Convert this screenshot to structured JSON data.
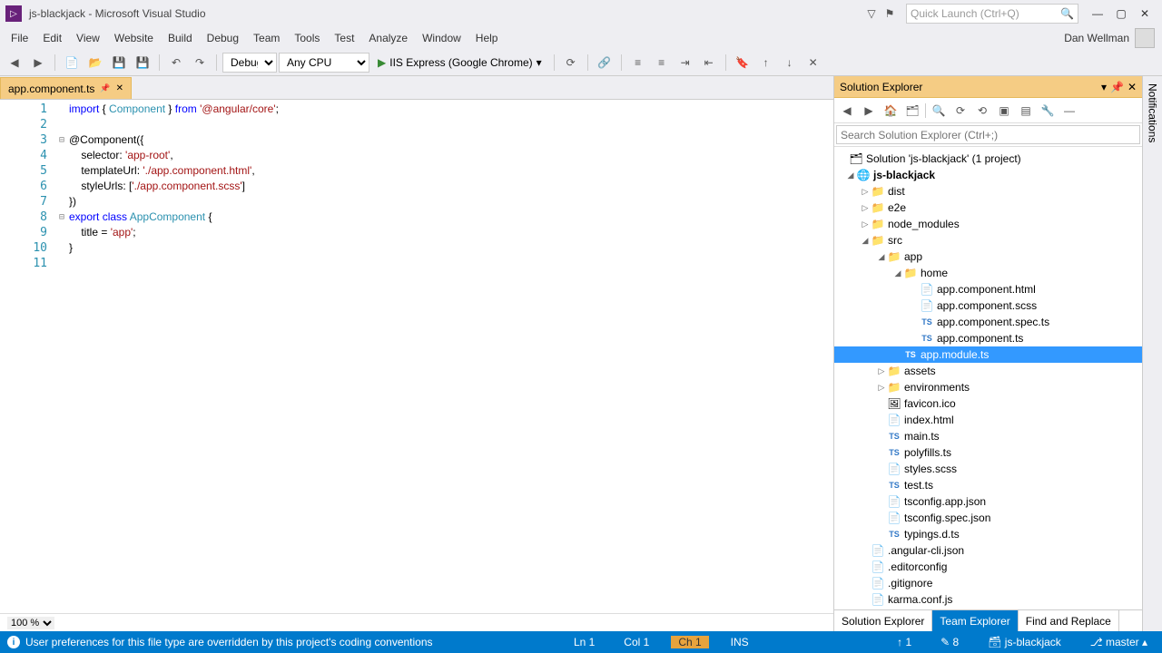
{
  "window": {
    "title": "js-blackjack - Microsoft Visual Studio"
  },
  "quicklaunch": {
    "placeholder": "Quick Launch (Ctrl+Q)"
  },
  "menu": {
    "items": [
      "File",
      "Edit",
      "View",
      "Website",
      "Build",
      "Debug",
      "Team",
      "Tools",
      "Test",
      "Analyze",
      "Window",
      "Help"
    ],
    "user": "Dan Wellman"
  },
  "toolbar": {
    "config": "Debug",
    "platform": "Any CPU",
    "run_label": "IIS Express (Google Chrome)"
  },
  "editor": {
    "tab_name": "app.component.ts",
    "zoom": "100 %",
    "lines": "11"
  },
  "code": {
    "l1a": "import",
    "l1b": " { ",
    "l1c": "Component",
    "l1d": " } ",
    "l1e": "from",
    "l1f": " ",
    "l1g": "'@angular/core'",
    "l1h": ";",
    "l3": "@Component({",
    "l4a": "    selector: ",
    "l4b": "'app-root'",
    "l4c": ",",
    "l5a": "    templateUrl: ",
    "l5b": "'./app.component.html'",
    "l5c": ",",
    "l6a": "    styleUrls: [",
    "l6b": "'./app.component.scss'",
    "l6c": "]",
    "l7": "})",
    "l8a": "export",
    "l8b": " ",
    "l8c": "class",
    "l8d": " ",
    "l8e": "AppComponent",
    "l8f": " {",
    "l9a": "    title = ",
    "l9b": "'app'",
    "l9c": ";",
    "l10": "}"
  },
  "solution": {
    "title": "Solution Explorer",
    "search_placeholder": "Search Solution Explorer (Ctrl+;)",
    "root": "Solution 'js-blackjack' (1 project)",
    "project": "js-blackjack",
    "folders": {
      "dist": "dist",
      "e2e": "e2e",
      "node_modules": "node_modules",
      "src": "src",
      "app": "app",
      "home": "home",
      "assets": "assets",
      "environments": "environments"
    },
    "files": {
      "app_html": "app.component.html",
      "app_scss": "app.component.scss",
      "app_spec": "app.component.spec.ts",
      "app_ts": "app.component.ts",
      "app_module": "app.module.ts",
      "favicon": "favicon.ico",
      "index": "index.html",
      "main": "main.ts",
      "polyfills": "polyfills.ts",
      "styles": "styles.scss",
      "test": "test.ts",
      "tsconfig_app": "tsconfig.app.json",
      "tsconfig_spec": "tsconfig.spec.json",
      "typings": "typings.d.ts",
      "angular_cli": ".angular-cli.json",
      "editorconfig": ".editorconfig",
      "gitignore": ".gitignore",
      "karma": "karma.conf.js"
    },
    "tabs": {
      "sol": "Solution Explorer",
      "team": "Team Explorer",
      "find": "Find and Replace"
    }
  },
  "right": {
    "notifications": "Notifications"
  },
  "statusbar": {
    "msg": "User preferences for this file type are overridden by this project's coding conventions",
    "ln": "Ln 1",
    "col": "Col 1",
    "ch": "Ch 1",
    "ins": "INS",
    "up": "1",
    "down": "8",
    "repo": "js-blackjack",
    "branch": "master"
  }
}
